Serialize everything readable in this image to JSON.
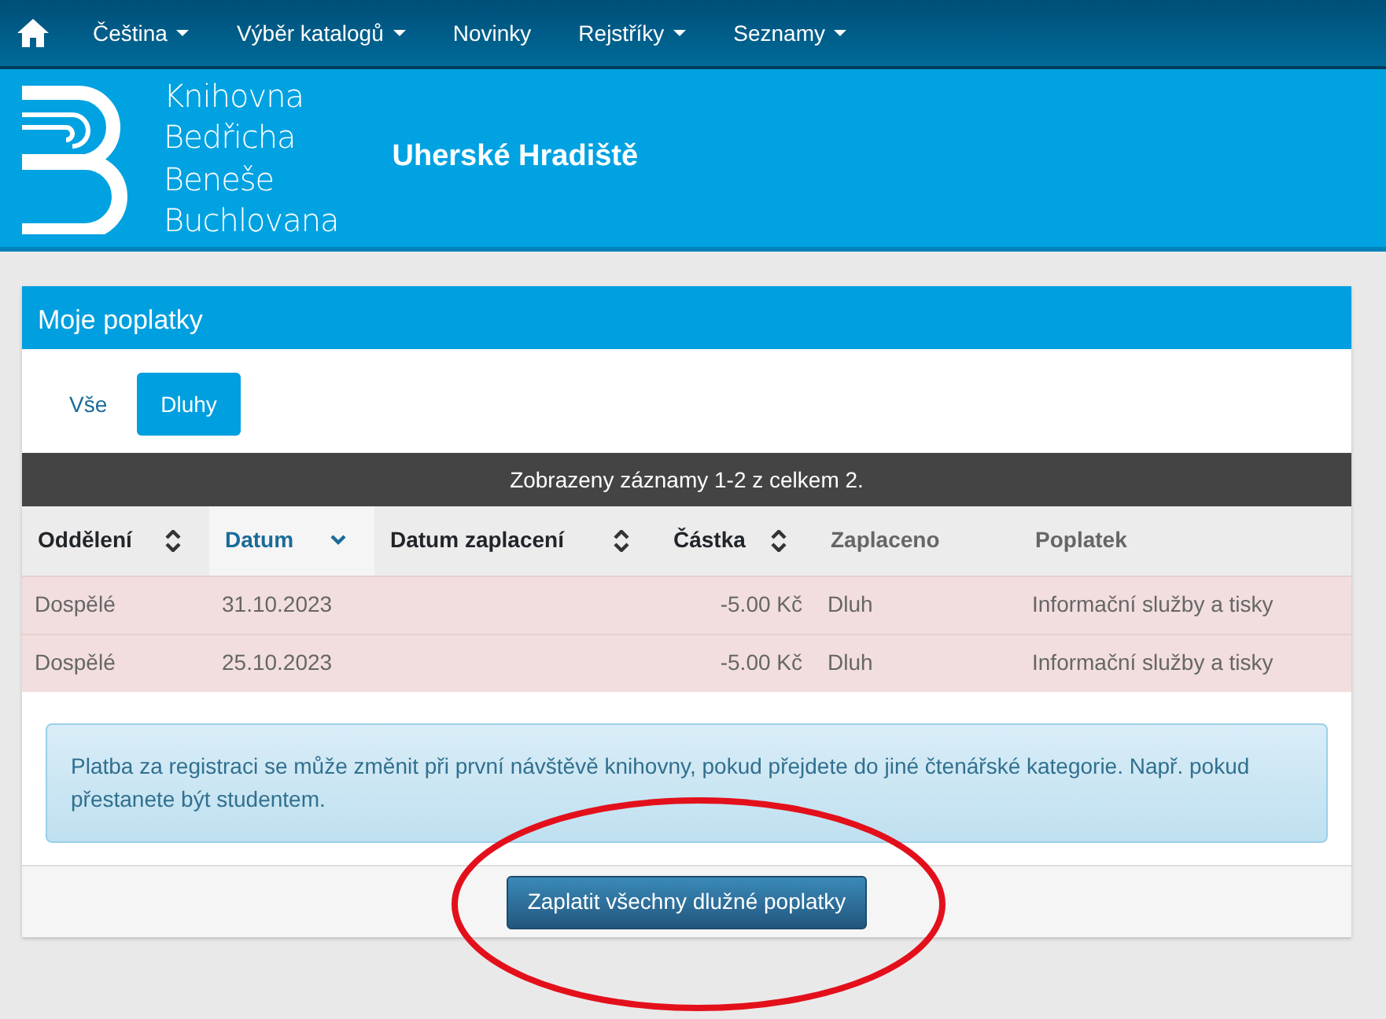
{
  "navbar": {
    "items": [
      {
        "label": "Čeština",
        "dropdown": true
      },
      {
        "label": "Výběr katalogů",
        "dropdown": true
      },
      {
        "label": "Novinky",
        "dropdown": false
      },
      {
        "label": "Rejstříky",
        "dropdown": true
      },
      {
        "label": "Seznamy",
        "dropdown": true
      }
    ]
  },
  "banner": {
    "logo_lines": [
      "Knihovna",
      "Bedřicha",
      "Beneše",
      "Buchlovana"
    ],
    "title": "Uherské Hradiště"
  },
  "panel": {
    "title": "Moje poplatky",
    "tabs": [
      {
        "label": "Vše",
        "selected": false
      },
      {
        "label": "Dluhy",
        "selected": true
      }
    ],
    "summary": "Zobrazeny záznamy 1-2 z celkem 2.",
    "table": {
      "columns": [
        {
          "label": "Oddělení",
          "sortable": true,
          "sorted": false
        },
        {
          "label": "Datum",
          "sortable": true,
          "sorted": true
        },
        {
          "label": "Datum zaplacení",
          "sortable": true,
          "sorted": false
        },
        {
          "label": "Částka",
          "sortable": true,
          "sorted": false
        },
        {
          "label": "Zaplaceno",
          "sortable": false,
          "sorted": false
        },
        {
          "label": "Poplatek",
          "sortable": false,
          "sorted": false
        }
      ],
      "rows": [
        [
          "Dospělé",
          "31.10.2023",
          "",
          "-5.00 Kč",
          "Dluh",
          "Informační služby a tisky"
        ],
        [
          "Dospělé",
          "25.10.2023",
          "",
          "-5.00 Kč",
          "Dluh",
          "Informační služby a tisky"
        ]
      ]
    },
    "notice": "Platba za registraci se může změnit při první návštěvě knihovny, pokud přejdete do jiné čtenářské kategorie. Např. pokud přestanete být studentem.",
    "pay_button": "Zaplatit všechny dlužné poplatky"
  },
  "annotation": {
    "kind": "ellipse",
    "color": "#e3101b"
  }
}
